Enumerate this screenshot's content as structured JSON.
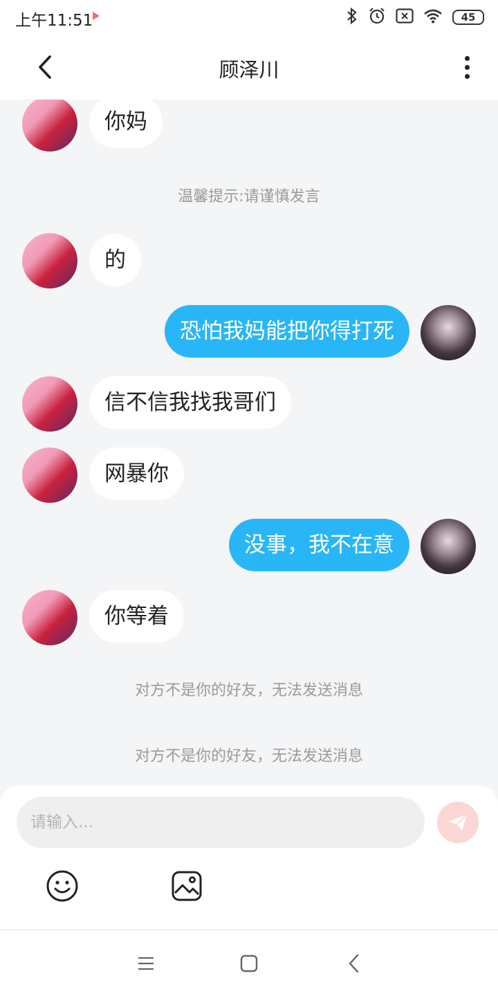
{
  "status_bar": {
    "time": "上午11:51",
    "battery": "45",
    "icons": [
      "app-indicator-icon",
      "bluetooth-icon",
      "alarm-icon",
      "no-sim-icon",
      "wifi-icon",
      "battery-icon"
    ]
  },
  "header": {
    "title": "顾泽川",
    "back_icon": "chevron-left-icon",
    "more_icon": "more-vertical-icon"
  },
  "messages": [
    {
      "side": "in",
      "text": "你妈"
    },
    {
      "side": "system",
      "text": "温馨提示:请谨慎发言"
    },
    {
      "side": "in",
      "text": "的"
    },
    {
      "side": "out",
      "text": "恐怕我妈能把你得打死"
    },
    {
      "side": "in",
      "text": "信不信我找我哥们"
    },
    {
      "side": "in",
      "text": "网暴你"
    },
    {
      "side": "out",
      "text": "没事，我不在意"
    },
    {
      "side": "in",
      "text": "你等着"
    },
    {
      "side": "system",
      "text": "对方不是你的好友，无法发送消息"
    },
    {
      "side": "system",
      "text": "对方不是你的好友，无法发送消息"
    }
  ],
  "composer": {
    "placeholder": "请输入...",
    "value": "",
    "send_icon": "paper-plane-icon",
    "tools": [
      "emoji-icon",
      "image-icon"
    ]
  },
  "nav_bar": {
    "buttons": [
      "menu-icon",
      "home-icon",
      "back-icon"
    ]
  },
  "colors": {
    "outgoing_bubble": "#29b6f6",
    "incoming_bubble": "#ffffff",
    "chat_background": "#f4f5f7",
    "send_button": "#fbd7d3"
  }
}
